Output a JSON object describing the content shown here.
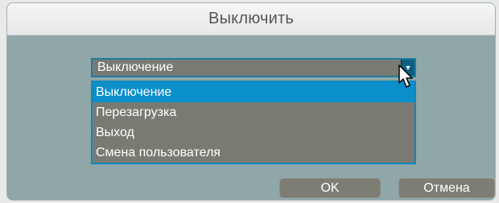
{
  "dialog": {
    "title": "Выключить",
    "select": {
      "value": "Выключение",
      "arrow_icon": "triangle-down-icon"
    },
    "options": [
      {
        "label": "Выключение",
        "selected": true
      },
      {
        "label": "Перезагрузка",
        "selected": false
      },
      {
        "label": "Выход",
        "selected": false
      },
      {
        "label": "Смена пользователя",
        "selected": false
      }
    ],
    "buttons": {
      "ok": "OK",
      "cancel": "Отмена"
    }
  },
  "colors": {
    "panel": "#8fa7a8",
    "field": "#7a7a72",
    "highlight": "#0b8fca",
    "title_text": "#555555"
  }
}
